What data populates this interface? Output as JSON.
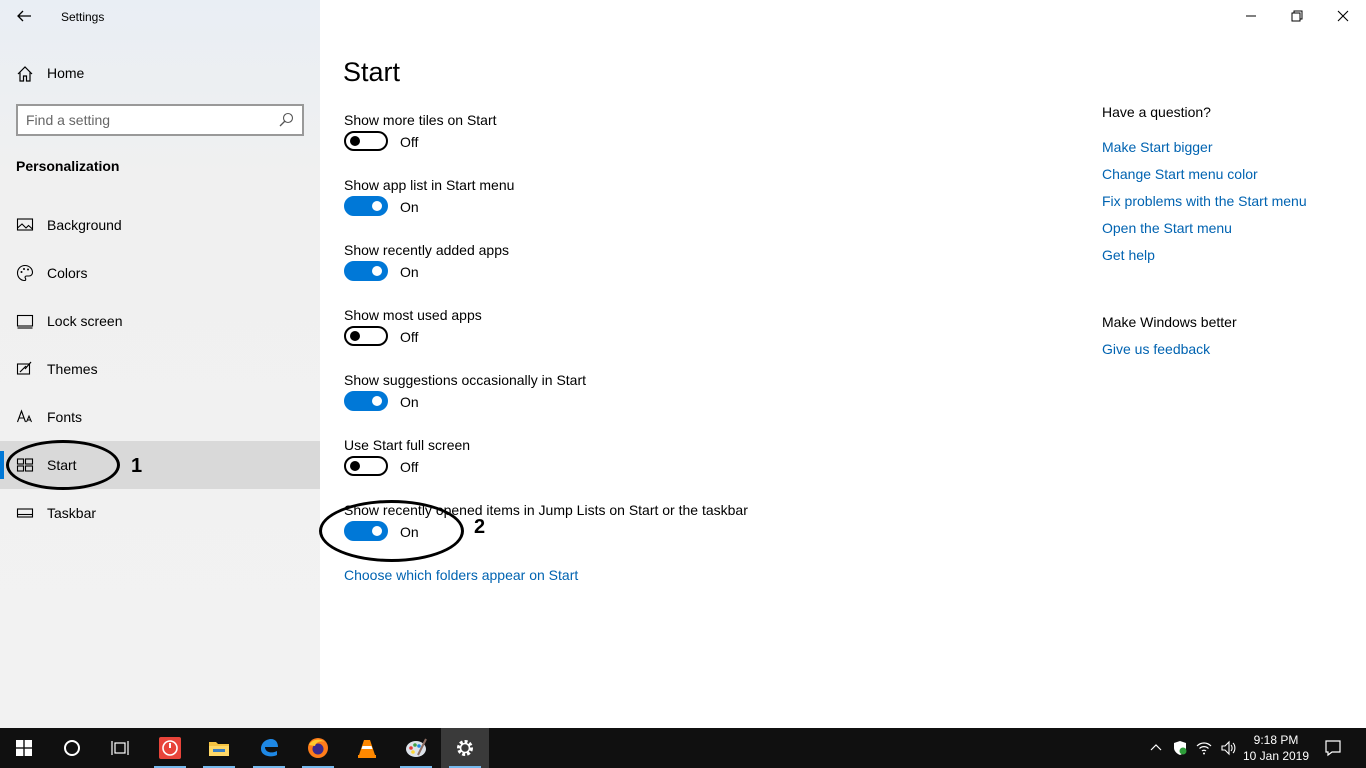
{
  "window": {
    "title": "Settings"
  },
  "sidebar": {
    "home_label": "Home",
    "search_placeholder": "Find a setting",
    "section_title": "Personalization",
    "items": [
      {
        "label": "Background",
        "icon": "picture-icon"
      },
      {
        "label": "Colors",
        "icon": "palette-icon"
      },
      {
        "label": "Lock screen",
        "icon": "lock-screen-icon"
      },
      {
        "label": "Themes",
        "icon": "themes-icon"
      },
      {
        "label": "Fonts",
        "icon": "fonts-icon"
      },
      {
        "label": "Start",
        "icon": "start-icon",
        "active": true
      },
      {
        "label": "Taskbar",
        "icon": "taskbar-icon"
      }
    ]
  },
  "main": {
    "page_title": "Start",
    "settings": [
      {
        "label": "Show more tiles on Start",
        "state": "Off"
      },
      {
        "label": "Show app list in Start menu",
        "state": "On"
      },
      {
        "label": "Show recently added apps",
        "state": "On"
      },
      {
        "label": "Show most used apps",
        "state": "Off"
      },
      {
        "label": "Show suggestions occasionally in Start",
        "state": "On"
      },
      {
        "label": "Use Start full screen",
        "state": "Off"
      },
      {
        "label": "Show recently opened items in Jump Lists on Start or the taskbar",
        "state": "On"
      }
    ],
    "folders_link": "Choose which folders appear on Start"
  },
  "help": {
    "question_heading": "Have a question?",
    "links": [
      "Make Start bigger",
      "Change Start menu color",
      "Fix problems with the Start menu",
      "Open the Start menu",
      "Get help"
    ],
    "feedback_heading": "Make Windows better",
    "feedback_link": "Give us feedback"
  },
  "annotations": {
    "one": "1",
    "two": "2"
  },
  "taskbar": {
    "time": "9:18 PM",
    "date": "10 Jan 2019"
  },
  "colors": {
    "accent": "#0078d7",
    "link": "#0063b1"
  }
}
